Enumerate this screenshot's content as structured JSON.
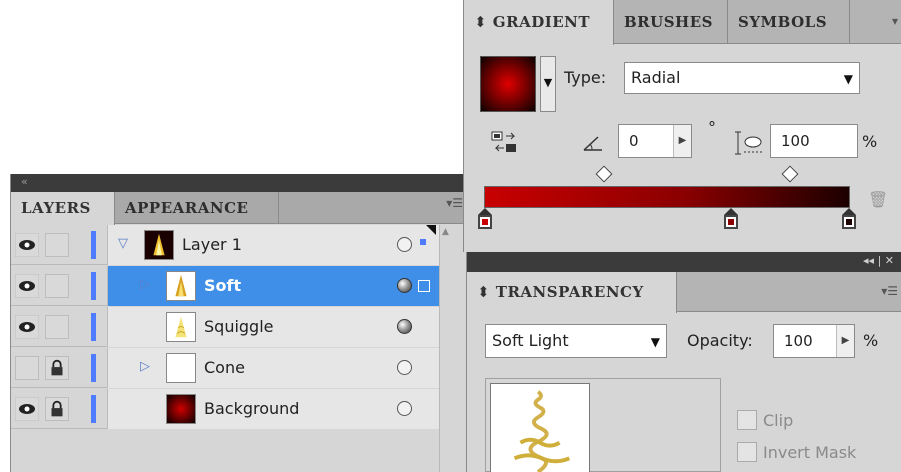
{
  "layers_panel": {
    "tabs": [
      "LAYERS",
      "APPEARANCE"
    ],
    "layers": [
      {
        "name": "Layer 1",
        "visible": true,
        "locked": false,
        "twist": "expanded",
        "thumb": "flame-thumb",
        "target": "empty",
        "selected": false
      },
      {
        "name": "Soft",
        "visible": true,
        "locked": false,
        "twist": "collapsed",
        "thumb": "flame-thumb",
        "target": "filled",
        "selected": true
      },
      {
        "name": "Squiggle",
        "visible": true,
        "locked": false,
        "twist": "none",
        "thumb": "squiggle-thumb",
        "target": "filled",
        "selected": false
      },
      {
        "name": "Cone",
        "visible": false,
        "locked": true,
        "twist": "collapsed",
        "thumb": "blank-thumb",
        "target": "empty",
        "selected": false
      },
      {
        "name": "Background",
        "visible": true,
        "locked": true,
        "twist": "none",
        "thumb": "radial-thumb",
        "target": "empty",
        "selected": false
      }
    ]
  },
  "gradient_panel": {
    "tabs": [
      "⬍ GRADIENT",
      "BRUSHES",
      "SYMBOLS"
    ],
    "type_label": "Type:",
    "type_value": "Radial",
    "angle_value": "0",
    "degree_symbol": "°",
    "aspect_value": "100",
    "percent_sign": "%",
    "colors": {
      "start": "#c80000",
      "mid": "#8a0000",
      "end": "#1c0000"
    }
  },
  "transparency_panel": {
    "tab": "⬍ TRANSPARENCY",
    "blend_mode": "Soft Light",
    "opacity_label": "Opacity:",
    "opacity_value": "100",
    "percent_sign": "%",
    "clip_label": "Clip",
    "invert_mask_label": "Invert Mask"
  }
}
